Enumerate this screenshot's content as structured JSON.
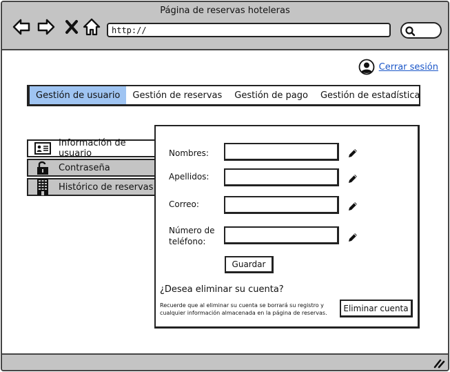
{
  "window": {
    "title": "Página de reservas hoteleras"
  },
  "browser": {
    "url": "http://",
    "nav_icons": [
      "back-arrow-icon",
      "forward-arrow-icon",
      "close-x-icon",
      "home-icon"
    ],
    "search_icon": "search-icon"
  },
  "header": {
    "logout_label": "Cerrar sesión",
    "user_icon": "user-avatar-icon"
  },
  "tabs": [
    {
      "label": "Gestión de usuario",
      "active": true
    },
    {
      "label": "Gestión de reservas",
      "active": false
    },
    {
      "label": "Gestión de pago",
      "active": false
    },
    {
      "label": "Gestión de estadística",
      "active": false
    }
  ],
  "sidebar": {
    "items": [
      {
        "label": "Información de usuario",
        "icon": "id-card-icon",
        "active": true
      },
      {
        "label": "Contraseña",
        "icon": "padlock-icon",
        "active": false
      },
      {
        "label": "Histórico de reservas",
        "icon": "building-icon",
        "active": false
      }
    ]
  },
  "form": {
    "fields": [
      {
        "label": "Nombres:",
        "value": ""
      },
      {
        "label": "Apellidos:",
        "value": ""
      },
      {
        "label": "Correo:",
        "value": ""
      },
      {
        "label_line1": "Número de",
        "label_line2": "teléfono:",
        "value": ""
      }
    ],
    "edit_icon": "pencil-edit-icon",
    "save_label": "Guardar"
  },
  "delete_account": {
    "question": "¿Desea eliminar su cuenta?",
    "note_line1": "Recuerde que al eliminar su cuenta se borrará su registro y",
    "note_line2": "cualquier información almacenada en la página de reservas.",
    "button_label": "Eliminar cuenta"
  },
  "colors": {
    "chrome_gray": "#c4c4c4",
    "active_tab": "#9fc4f2",
    "link_blue": "#1a56c8"
  }
}
